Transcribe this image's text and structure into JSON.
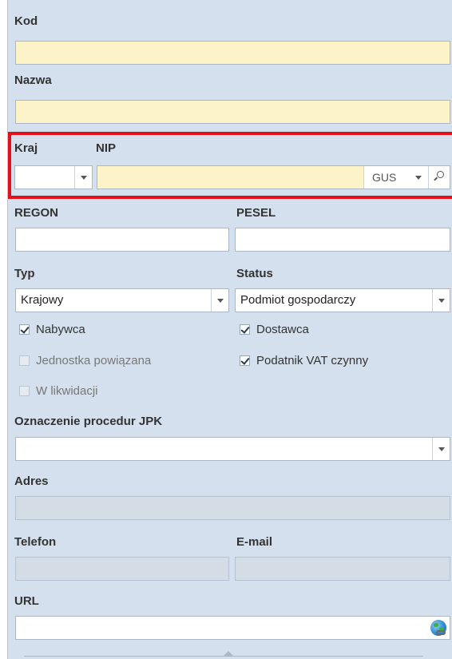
{
  "labels": {
    "kod": "Kod",
    "nazwa": "Nazwa",
    "kraj": "Kraj",
    "nip": "NIP",
    "regon": "REGON",
    "pesel": "PESEL",
    "typ": "Typ",
    "status": "Status",
    "jpk": "Oznaczenie procedur JPK",
    "adres": "Adres",
    "telefon": "Telefon",
    "email": "E-mail",
    "url": "URL"
  },
  "fields": {
    "kod": "",
    "nazwa": "",
    "kraj": "",
    "nip": "",
    "nip_source": "GUS",
    "regon": "",
    "pesel": "",
    "typ": "Krajowy",
    "status": "Podmiot gospodarczy",
    "jpk": "",
    "adres": "",
    "telefon": "",
    "email": "",
    "url": ""
  },
  "checkboxes": [
    {
      "label": "Nabywca",
      "checked": true,
      "enabled": true
    },
    {
      "label": "Dostawca",
      "checked": true,
      "enabled": true
    },
    {
      "label": "Jednostka powiązana",
      "checked": false,
      "enabled": false
    },
    {
      "label": "Podatnik VAT czynny",
      "checked": true,
      "enabled": true
    },
    {
      "label": "W likwidacji",
      "checked": false,
      "enabled": false
    }
  ],
  "colors": {
    "panel": "#d5e0ee",
    "required_field": "#fcf4c8",
    "highlight": "#e3101c"
  },
  "icons": {
    "dropdown": "chevron-down-icon",
    "search": "search-icon",
    "url_open": "globe-link-icon"
  }
}
